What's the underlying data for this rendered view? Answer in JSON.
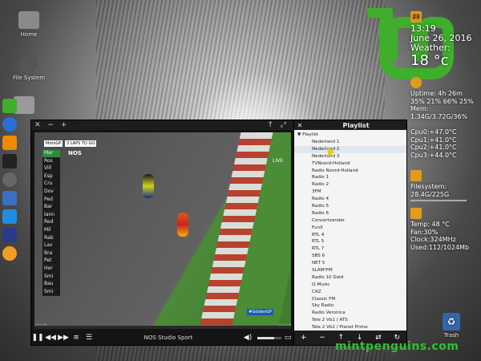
{
  "desktop": {
    "icons": [
      {
        "label": "Home"
      },
      {
        "label": "File System"
      }
    ],
    "trash_label": "Trash",
    "watermark": "mintpenguins.com"
  },
  "conky": {
    "date_badge": "23",
    "time": "13:19",
    "date": "June 26, 2016",
    "weather_label": "Weather:",
    "temp": "18 °c",
    "uptime": "Uptime: 4h 26m",
    "cpu_usage": "35% 21% 66% 25%",
    "mem_label": "Mem:",
    "mem": "1.34G/3.72G/36%",
    "cpus": [
      "Cpu0:+47.0°C",
      "Cpu1:+41.0°C",
      "Cpu2:+41.0°C",
      "Cpu3:+44.0°C"
    ],
    "fs_label": "Filesystem:",
    "fs": "28.4G/225G",
    "gpu_temp": "Temp: 48 °C",
    "gpu_fan": "Fan:30%",
    "gpu_clock": "Clock:324MHz",
    "gpu_used": "Used:112/1024Mb"
  },
  "player": {
    "title_left": [
      "✕",
      "−",
      "+"
    ],
    "title_right": [
      "↑",
      "⤢"
    ],
    "now_playing": "NOS Studio Sport",
    "progress": 0,
    "volume": 0.7,
    "overlay": {
      "motogp": "MotoGP",
      "laps": "3 LAPS TO GO",
      "channel": "NOS",
      "live": "LIVE",
      "tag": "#GoldenGP",
      "standings": [
        "Mar",
        "Ros",
        "Viñ",
        "Esp",
        "Cru",
        "Dov",
        "Ped",
        "Bar",
        "Iann",
        "Red",
        "Mil",
        "Rab",
        "Lav",
        "Bra",
        "Pet",
        "Her",
        "Smi",
        "Bau",
        "Smi"
      ]
    },
    "time_left": "0:03:08",
    "time_right": "0:03:08"
  },
  "playlist": {
    "title": "Playlist",
    "close": "✕",
    "group": "Playlist",
    "items": [
      "Nederland 1",
      "Nederland 2",
      "Nederland 3",
      "TVNoord-Holland",
      "Radio Noord-Holland",
      "Radio 1",
      "Radio 2",
      "3FM",
      "Radio 4",
      "Radio 5",
      "Radio 6",
      "Concertzender",
      "FunX",
      "RTL 4",
      "RTL 5",
      "RTL 7",
      "SBS 6",
      "NET 5",
      "SLAM!FM",
      "Radio 10 Gold",
      "Q-Music",
      "CAZ",
      "Classic FM",
      "Sky Radio",
      "Radio Veronica",
      "Tele 2 Vb1 / ATS",
      "Tele 2 Vb2 / Planet Prime"
    ],
    "selected_index": 1,
    "toolbar": [
      "+",
      "−",
      "↑",
      "↓",
      "⇄",
      "↻"
    ]
  }
}
